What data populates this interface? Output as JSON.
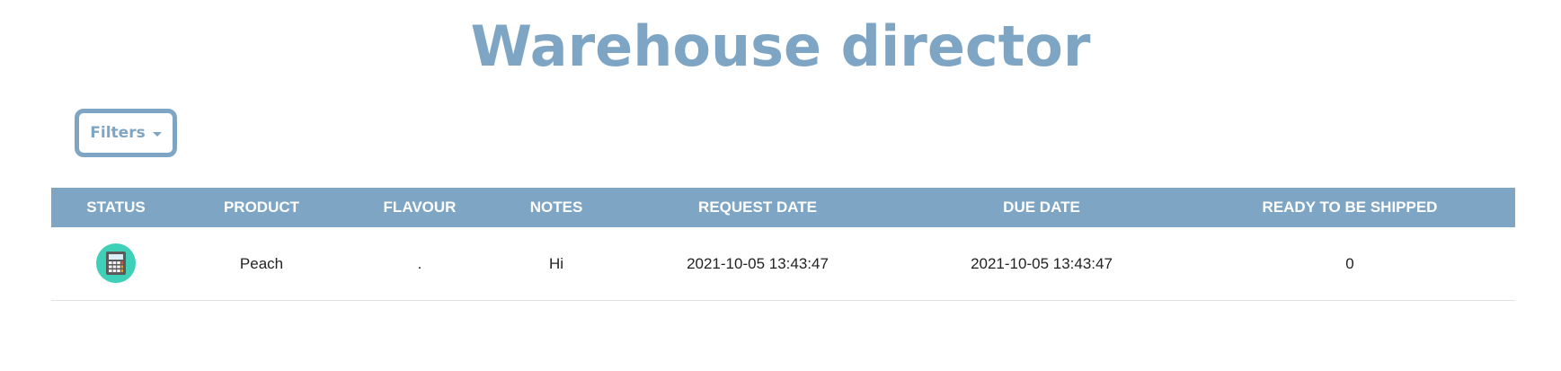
{
  "header": {
    "title": "Warehouse director"
  },
  "filters": {
    "label": "Filters"
  },
  "table": {
    "columns": [
      "STATUS",
      "PRODUCT",
      "FLAVOUR",
      "NOTES",
      "REQUEST DATE",
      "DUE DATE",
      "READY TO BE SHIPPED"
    ],
    "rows": [
      {
        "status_icon": "calculator-icon",
        "product": "Peach",
        "flavour": ".",
        "notes": "Hi",
        "request_date": "2021-10-05 13:43:47",
        "due_date": "2021-10-05 13:43:47",
        "ready_to_be_shipped": "0"
      }
    ]
  },
  "colors": {
    "accent": "#7ea6c4",
    "status_badge": "#3fd1b8"
  }
}
